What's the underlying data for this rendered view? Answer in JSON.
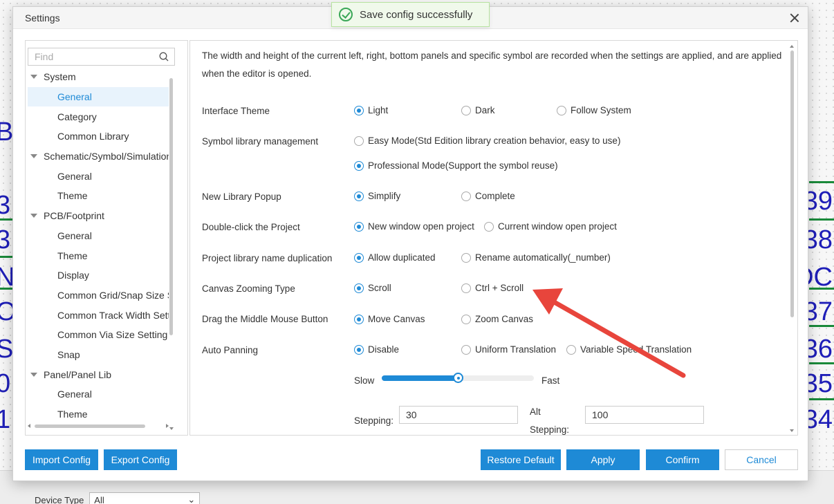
{
  "toast": {
    "message": "Save config successfully"
  },
  "dialog": {
    "title": "Settings"
  },
  "search": {
    "placeholder": "Find"
  },
  "tree": {
    "items": [
      {
        "label": "System",
        "type": "group"
      },
      {
        "label": "General",
        "type": "child",
        "selected": true
      },
      {
        "label": "Category",
        "type": "child"
      },
      {
        "label": "Common Library",
        "type": "child"
      },
      {
        "label": "Schematic/Symbol/Simulation",
        "type": "group"
      },
      {
        "label": "General",
        "type": "child"
      },
      {
        "label": "Theme",
        "type": "child"
      },
      {
        "label": "PCB/Footprint",
        "type": "group"
      },
      {
        "label": "General",
        "type": "child"
      },
      {
        "label": "Theme",
        "type": "child"
      },
      {
        "label": "Display",
        "type": "child"
      },
      {
        "label": "Common Grid/Snap Size Se",
        "type": "child"
      },
      {
        "label": "Common Track Width Settin",
        "type": "child"
      },
      {
        "label": "Common Via Size Setting",
        "type": "child"
      },
      {
        "label": "Snap",
        "type": "child"
      },
      {
        "label": "Panel/Panel Lib",
        "type": "group"
      },
      {
        "label": "General",
        "type": "child"
      },
      {
        "label": "Theme",
        "type": "child"
      }
    ]
  },
  "content": {
    "description": "The width and height of the current left, right, bottom panels and specific symbol are recorded when the settings are applied, and are applied when the editor is opened.",
    "interface_theme": {
      "label": "Interface Theme",
      "options": [
        "Light",
        "Dark",
        "Follow System"
      ],
      "selected": "Light"
    },
    "symbol_lib": {
      "label": "Symbol library management",
      "options": [
        "Easy Mode(Std Edition library creation behavior, easy to use)",
        "Professional Mode(Support the symbol reuse)"
      ],
      "selected": "Professional Mode(Support the symbol reuse)"
    },
    "new_lib_popup": {
      "label": "New Library Popup",
      "options": [
        "Simplify",
        "Complete"
      ],
      "selected": "Simplify"
    },
    "double_click": {
      "label": "Double-click the Project",
      "options": [
        "New window open project",
        "Current window open project"
      ],
      "selected": "New window open project"
    },
    "lib_dup": {
      "label": "Project library name duplication",
      "options": [
        "Allow duplicated",
        "Rename automatically(_number)"
      ],
      "selected": "Allow duplicated"
    },
    "zoom": {
      "label": "Canvas Zooming Type",
      "options": [
        "Scroll",
        "Ctrl + Scroll"
      ],
      "selected": "Scroll"
    },
    "middle": {
      "label": "Drag the Middle Mouse Button",
      "options": [
        "Move Canvas",
        "Zoom Canvas"
      ],
      "selected": "Move Canvas"
    },
    "panning": {
      "label": "Auto Panning",
      "options": [
        "Disable",
        "Uniform Translation",
        "Variable Speed Translation"
      ],
      "selected": "Disable"
    },
    "speed": {
      "slow": "Slow",
      "fast": "Fast",
      "value": 0.5
    },
    "stepping": {
      "label": "Stepping:",
      "value": "30",
      "alt_label_1": "Alt",
      "alt_label_2": "Stepping:",
      "alt_value": "100"
    }
  },
  "buttons": {
    "import": "Import Config",
    "export": "Export Config",
    "restore": "Restore Default",
    "apply": "Apply",
    "confirm": "Confirm",
    "cancel": "Cancel"
  },
  "background": {
    "device_type_label": "Device Type",
    "device_type_value": "All"
  },
  "colors": {
    "accent": "#1e8ad6",
    "arrow": "#e8453c",
    "success": "#3aa757"
  }
}
